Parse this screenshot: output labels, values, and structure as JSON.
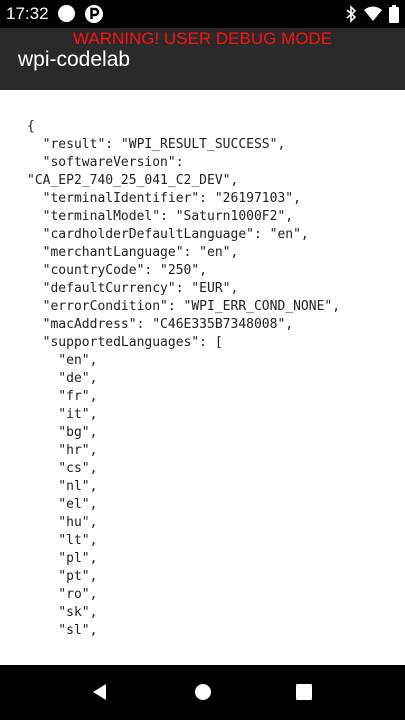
{
  "status_bar": {
    "time": "17:32",
    "icons": [
      "notification-circle-icon",
      "p-app-icon",
      "bluetooth-icon",
      "wifi-icon",
      "battery-icon"
    ]
  },
  "app_bar": {
    "warning": "WARNING! USER DEBUG MODE",
    "warning_color": "#ff1010",
    "title": "wpi-codelab"
  },
  "json_lines": [
    "{",
    "  \"result\": \"WPI_RESULT_SUCCESS\",",
    "  \"softwareVersion\":",
    "\"CA_EP2_740_25_041_C2_DEV\",",
    "  \"terminalIdentifier\": \"26197103\",",
    "  \"terminalModel\": \"Saturn1000F2\",",
    "  \"cardholderDefaultLanguage\": \"en\",",
    "  \"merchantLanguage\": \"en\",",
    "  \"countryCode\": \"250\",",
    "  \"defaultCurrency\": \"EUR\",",
    "  \"errorCondition\": \"WPI_ERR_COND_NONE\",",
    "  \"macAddress\": \"C46E335B7348008\",",
    "  \"supportedLanguages\": [",
    "    \"en\",",
    "    \"de\",",
    "    \"fr\",",
    "    \"it\",",
    "    \"bg\",",
    "    \"hr\",",
    "    \"cs\",",
    "    \"nl\",",
    "    \"el\",",
    "    \"hu\",",
    "    \"lt\",",
    "    \"pl\",",
    "    \"pt\",",
    "    \"ro\",",
    "    \"sk\",",
    "    \"sl\","
  ],
  "nav_bar": {
    "buttons": [
      "back-icon",
      "home-icon",
      "recents-icon"
    ]
  }
}
